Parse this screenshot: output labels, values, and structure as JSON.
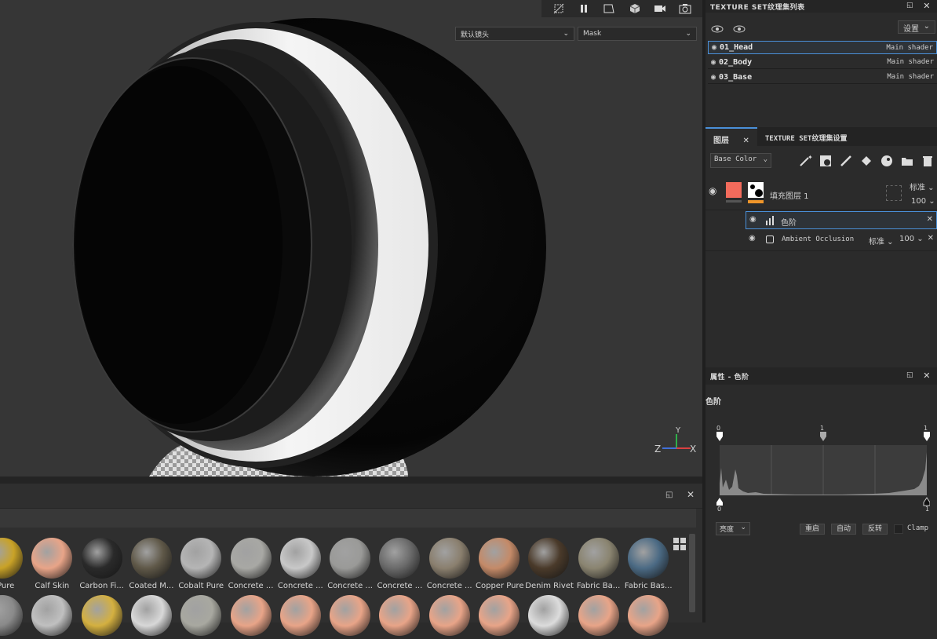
{
  "viewport": {
    "camera_select": "默认镜头",
    "channel_select": "Mask"
  },
  "toolbar": {
    "icons": [
      "no-camera-icon",
      "pause-icon",
      "frame-icon",
      "cube-icon",
      "video-camera-icon",
      "screenshot-icon"
    ]
  },
  "axis": {
    "y": "Y",
    "z": "Z",
    "x": "X"
  },
  "texture_sets": {
    "title": "TEXTURE SET纹理集列表",
    "settings_label": "设置",
    "items": [
      {
        "name": "01_Head",
        "shader": "Main shader",
        "selected": true
      },
      {
        "name": "02_Body",
        "shader": "Main shader",
        "selected": false
      },
      {
        "name": "03_Base",
        "shader": "Main shader",
        "selected": false
      }
    ]
  },
  "layers": {
    "tab_layers": "图层",
    "tab_settings": "TEXTURE SET纹理集设置",
    "channel_select": "Base Color",
    "fill_layer": {
      "name": "填充图层 1",
      "blend": "标准",
      "opacity": "100"
    },
    "effects": [
      {
        "name": "色阶",
        "selected": true
      },
      {
        "name": "Ambient Occlusion",
        "blend": "标准",
        "opacity": "100",
        "selected": false
      }
    ]
  },
  "properties": {
    "title": "属性 - 色阶",
    "section": "色阶",
    "input_labels": {
      "low": "0",
      "mid": "1",
      "high": "1"
    },
    "output_labels": {
      "low": "0",
      "high": "1"
    },
    "mode_select": "亮度",
    "reset_label": "重启",
    "auto_label": "自动",
    "invert_label": "反转",
    "clamp_label": "Clamp"
  },
  "shelf": {
    "row1": [
      {
        "label": "s Pure",
        "color": "#c9a227"
      },
      {
        "label": "Calf Skin",
        "color": "#e8a488"
      },
      {
        "label": "Carbon Fi...",
        "color": "#2a2a2a"
      },
      {
        "label": "Coated M...",
        "color": "#5f5848"
      },
      {
        "label": "Cobalt Pure",
        "color": "#b5b5b5"
      },
      {
        "label": "Concrete ...",
        "color": "#a8a8a4"
      },
      {
        "label": "Concrete ...",
        "color": "#c8c8c8"
      },
      {
        "label": "Concrete ...",
        "color": "#9a9a98"
      },
      {
        "label": "Concrete ...",
        "color": "#6a6a6a"
      },
      {
        "label": "Concrete ...",
        "color": "#8a7f6e"
      },
      {
        "label": "Copper Pure",
        "color": "#c48a68"
      },
      {
        "label": "Denim Rivet",
        "color": "#4a3a2a"
      },
      {
        "label": "Fabric Ba...",
        "color": "#8a8470"
      },
      {
        "label": "Fabric Bas...",
        "color": "#4b6a84"
      }
    ],
    "row2_colors": [
      "#8a8a8a",
      "#c0c0c0",
      "#d4b040",
      "#d8d8d8",
      "#a8a8a0",
      "#e8a488",
      "#e8a488",
      "#e8a488",
      "#e8a488",
      "#e8a488",
      "#e8a488",
      "#dcdcdc",
      "#e8a488",
      "#e8a488"
    ]
  },
  "colors": {
    "accent": "#4a90d9",
    "fill_swatch": "#f26b5c",
    "mask_bar": "#f0962a"
  }
}
